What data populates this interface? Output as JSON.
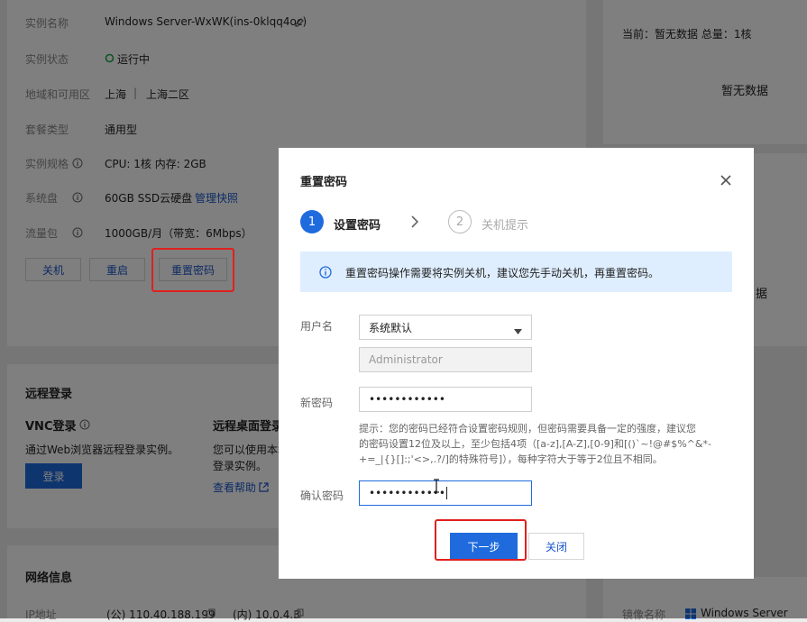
{
  "instance": {
    "name_label": "实例名称",
    "name_value": "Windows Server-WxWK(ins-0klqq4oc)",
    "status_label": "实例状态",
    "status_value": "运行中",
    "region_label": "地域和可用区",
    "region_value": "上海",
    "zone_value": "上海二区",
    "package_label": "套餐类型",
    "package_value": "通用型",
    "spec_label": "实例规格",
    "spec_value": "CPU: 1核 内存: 2GB",
    "disk_label": "系统盘",
    "disk_value": "60GB SSD云硬盘",
    "disk_link": "管理快照",
    "traffic_label": "流量包",
    "traffic_value": "1000GB/月（带宽：6Mbps）",
    "btn_shutdown": "关机",
    "btn_restart": "重启",
    "btn_reset_password": "重置密码"
  },
  "right_panel": {
    "current_text": "当前：暂无数据 总量：1核",
    "no_data": "暂无数据",
    "no_data_partial": "据",
    "image_label": "镜像名称",
    "image_value": "Windows Server"
  },
  "remote_login": {
    "title": "远程登录",
    "vnc_title": "VNC登录",
    "vnc_desc": "通过Web浏览器远程登录实例。",
    "vnc_button": "登录",
    "rdp_title": "远程桌面登录",
    "rdp_desc_1": "您可以使用本地",
    "rdp_desc_2": "登录实例。",
    "rdp_help": "查看帮助"
  },
  "network": {
    "title": "网络信息",
    "ip_label": "IP地址",
    "public_ip": "(公) 110.40.188.199",
    "private_ip": "(内) 10.0.4.3"
  },
  "modal": {
    "title": "重置密码",
    "step1_num": "1",
    "step1_label": "设置密码",
    "step2_num": "2",
    "step2_label": "关机提示",
    "notice": "重置密码操作需要将实例关机，建议您先手动关机，再重置密码。",
    "username_label": "用户名",
    "username_select": "系统默认",
    "username_value": "Administrator",
    "new_password_label": "新密码",
    "new_password_value": "••••••••••••",
    "hint_1": "提示：您的密码已经符合设置密码规则，但密码需要具备一定的强度，建议您",
    "hint_2": "的密码设置12位及以上，至少包括4项（[a-z],[A-Z],[0-9]和[()`~!@#$%^&*-",
    "hint_3": "+=_|{}[]:;'<>,.?/]的特殊符号]），每种字符大于等于2位且不相同。",
    "confirm_password_label": "确认密码",
    "confirm_password_value": "••••••••••••",
    "next_button": "下一步",
    "close_button": "关闭"
  },
  "colors": {
    "primary": "#1f6bde",
    "highlight": "#e02020",
    "notice_bg": "#dfeeff",
    "status_green": "#1aa84a"
  }
}
